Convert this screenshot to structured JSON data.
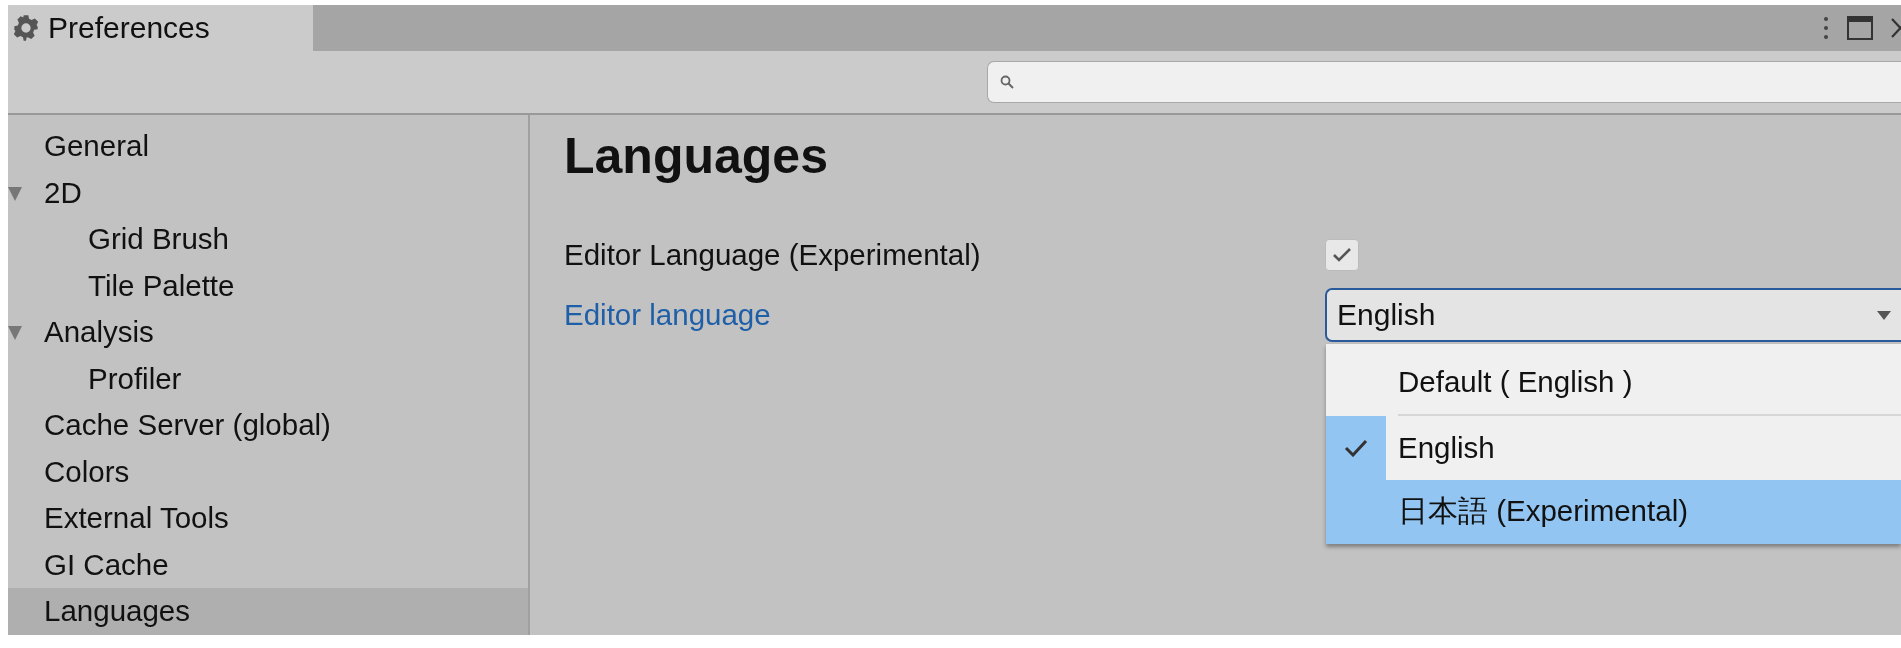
{
  "window": {
    "title": "Preferences"
  },
  "sidebar": {
    "items": [
      {
        "label": "General",
        "selected": false
      },
      {
        "label": "2D",
        "selected": false,
        "expanded": true,
        "children": [
          {
            "label": "Grid Brush",
            "selected": false
          },
          {
            "label": "Tile Palette",
            "selected": false
          }
        ]
      },
      {
        "label": "Analysis",
        "selected": false,
        "expanded": true,
        "children": [
          {
            "label": "Profiler",
            "selected": false
          }
        ]
      },
      {
        "label": "Cache Server (global)",
        "selected": false
      },
      {
        "label": "Colors",
        "selected": false
      },
      {
        "label": "External Tools",
        "selected": false
      },
      {
        "label": "GI Cache",
        "selected": false
      },
      {
        "label": "Languages",
        "selected": true
      }
    ]
  },
  "content": {
    "heading": "Languages",
    "settings": [
      {
        "kind": "checkbox",
        "label": "Editor Language (Experimental)",
        "checked": true
      },
      {
        "kind": "dropdown",
        "label": "Editor language",
        "value": "English",
        "open": true,
        "options": [
          {
            "label": "Default ( English )",
            "checked": false,
            "highlighted": false,
            "separator_after": true
          },
          {
            "label": "English",
            "checked": true,
            "highlighted": false,
            "separator_after": false
          },
          {
            "label": "日本語 (Experimental)",
            "checked": false,
            "highlighted": true,
            "separator_after": false
          }
        ]
      }
    ]
  }
}
